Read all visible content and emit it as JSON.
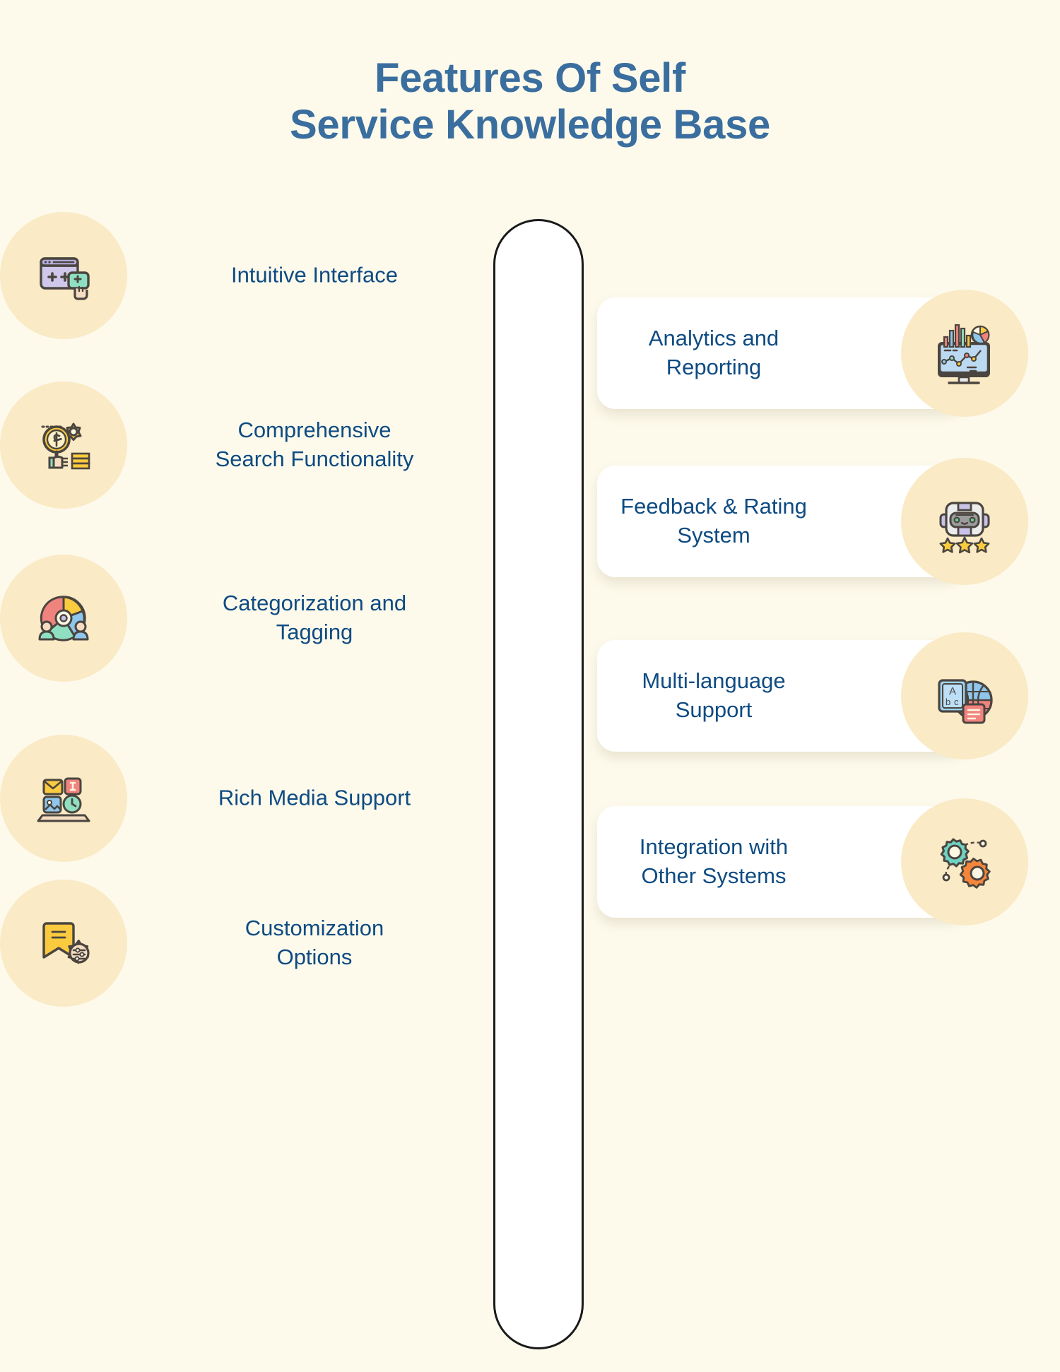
{
  "page": {
    "background_color": "#fdfaec",
    "title_color": "#3a6e9e",
    "label_color": "#0e4b82",
    "bubble_color": "#faeac5",
    "card_color": "#ffffff"
  },
  "header": {
    "title_line1": "Features Of Self",
    "title_line2": "Service Knowledge Base"
  },
  "features": {
    "left": [
      {
        "label": "Intuitive Interface",
        "icon": "browser-cursor-icon"
      },
      {
        "label": "Comprehensive\nSearch Functionality",
        "icon": "magnifier-gear-coins-icon"
      },
      {
        "label": "Categorization and\nTagging",
        "icon": "pie-people-icon"
      },
      {
        "label": "Rich Media Support",
        "icon": "media-laptop-icon"
      },
      {
        "label": "Customization\nOptions",
        "icon": "bookmark-gear-icon"
      }
    ],
    "right": [
      {
        "label": "Analytics and\nReporting",
        "icon": "monitor-charts-icon"
      },
      {
        "label": "Feedback & Rating\nSystem",
        "icon": "robot-stars-icon"
      },
      {
        "label": "Multi-language\nSupport",
        "icon": "abc-globe-icon"
      },
      {
        "label": "Integration with\nOther Systems",
        "icon": "gears-network-icon"
      }
    ]
  }
}
